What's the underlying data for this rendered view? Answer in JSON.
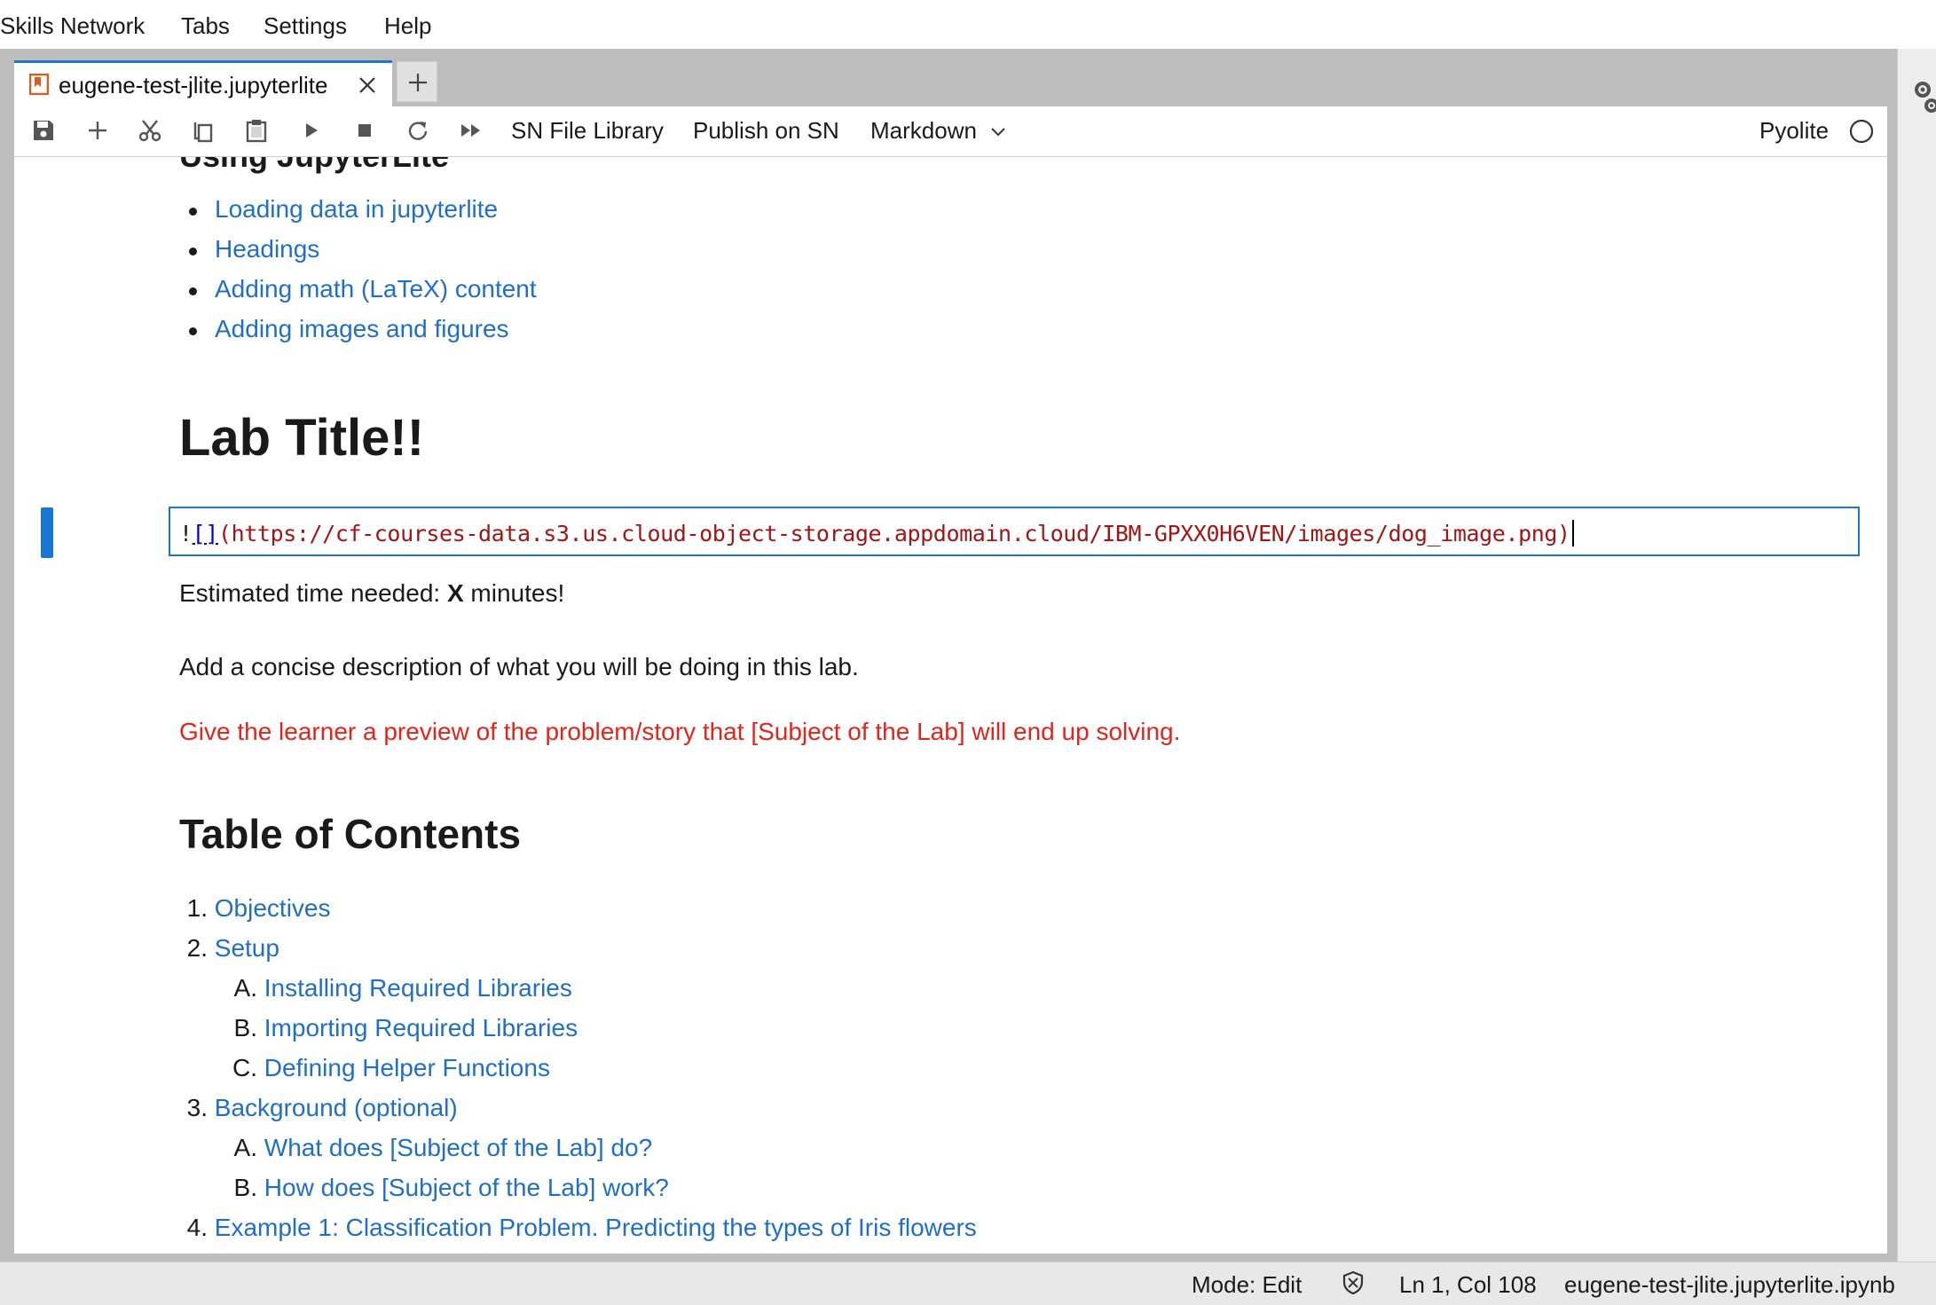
{
  "menubar": {
    "items": [
      "Skills Network",
      "Tabs",
      "Settings",
      "Help"
    ]
  },
  "tabs": {
    "active_label": "eugene-test-jlite.jupyterlite",
    "file_icon": "notebook-file-icon",
    "close_icon": "close-icon",
    "add_icon": "plus-icon"
  },
  "toolbar": {
    "icons": [
      "save-icon",
      "add-cell-icon",
      "cut-icon",
      "copy-icon",
      "paste-icon",
      "run-icon",
      "stop-icon",
      "restart-icon",
      "fast-forward-icon"
    ],
    "sn_file_library": "SN File Library",
    "publish": "Publish on SN",
    "cell_type": "Markdown",
    "kernel_name": "Pyolite",
    "kernel_status_icon": "kernel-idle-icon"
  },
  "notebook": {
    "clipped_heading": "Using JupyterLite",
    "bullet_links": [
      "Loading data in jupyterlite",
      "Headings",
      "Adding math (LaTeX) content",
      "Adding images and figures"
    ],
    "lab_title": "Lab Title!!",
    "editor": {
      "bang": "!",
      "brackets": "[]",
      "url": "(https://cf-courses-data.s3.us.cloud-object-storage.appdomain.cloud/IBM-GPXX0H6VEN/images/dog_image.png)"
    },
    "time_prefix": "Estimated time needed: ",
    "time_value": "X",
    "time_suffix": " minutes!",
    "description": "Add a concise description of what you will be doing in this lab.",
    "preview": "Give the learner a preview of the problem/story that [Subject of the Lab] will end up solving.",
    "toc_title": "Table of Contents",
    "toc": [
      {
        "marker": "1.",
        "label": "Objectives",
        "level": 1
      },
      {
        "marker": "2.",
        "label": "Setup",
        "level": 1
      },
      {
        "marker": "A.",
        "label": "Installing Required Libraries",
        "level": 2
      },
      {
        "marker": "B.",
        "label": "Importing Required Libraries",
        "level": 2
      },
      {
        "marker": "C.",
        "label": "Defining Helper Functions",
        "level": 2
      },
      {
        "marker": "3.",
        "label": "Background (optional)",
        "level": 1
      },
      {
        "marker": "A.",
        "label": "What does [Subject of the Lab] do?",
        "level": 2
      },
      {
        "marker": "B.",
        "label": "How does [Subject of the Lab] work?",
        "level": 2
      },
      {
        "marker": "4.",
        "label": "Example 1: Classification Problem. Predicting the types of Iris flowers",
        "level": 1
      }
    ]
  },
  "statusbar": {
    "mode": "Mode: Edit",
    "trust_icon": "shield-icon",
    "position": "Ln 1, Col 108",
    "filename": "eugene-test-jlite.jupyterlite.ipynb"
  },
  "colors": {
    "accent": "#1976d2",
    "link": "#1f6fc9",
    "warning_text": "#e3241b"
  }
}
